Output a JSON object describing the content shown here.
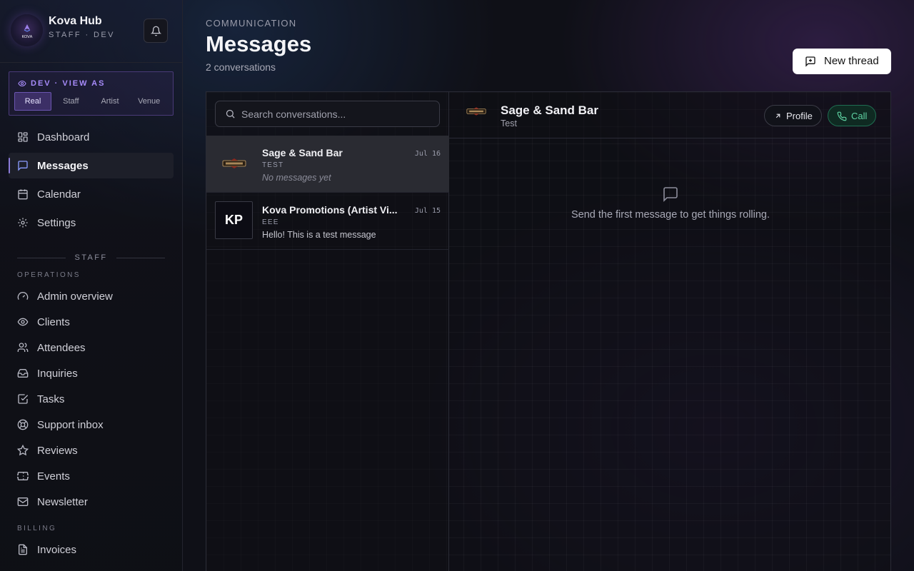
{
  "sidebar": {
    "app_title": "Kova Hub",
    "app_subtitle": "STAFF · DEV",
    "logo_text": "KOVA",
    "dev": {
      "label": "DEV · VIEW AS",
      "options": [
        "Real",
        "Staff",
        "Artist",
        "Venue"
      ],
      "selected": "Real"
    },
    "nav": [
      {
        "label": "Dashboard",
        "icon": "dashboard-icon"
      },
      {
        "label": "Messages",
        "icon": "message-icon",
        "active": true
      },
      {
        "label": "Calendar",
        "icon": "calendar-icon"
      },
      {
        "label": "Settings",
        "icon": "gear-icon"
      }
    ],
    "staff_section": "STAFF",
    "operations_group": "OPERATIONS",
    "operations": [
      {
        "label": "Admin overview",
        "icon": "gauge-icon"
      },
      {
        "label": "Clients",
        "icon": "eye-icon"
      },
      {
        "label": "Attendees",
        "icon": "users-icon"
      },
      {
        "label": "Inquiries",
        "icon": "inbox-icon"
      },
      {
        "label": "Tasks",
        "icon": "checkbox-icon"
      },
      {
        "label": "Support inbox",
        "icon": "lifebuoy-icon"
      },
      {
        "label": "Reviews",
        "icon": "star-icon"
      },
      {
        "label": "Events",
        "icon": "ticket-icon"
      },
      {
        "label": "Newsletter",
        "icon": "mail-icon"
      }
    ],
    "billing_group": "BILLING",
    "billing": [
      {
        "label": "Invoices",
        "icon": "document-icon"
      }
    ]
  },
  "header": {
    "eyebrow": "COMMUNICATION",
    "title": "Messages",
    "subtitle": "2 conversations",
    "new_thread_label": "New thread"
  },
  "search": {
    "placeholder": "Search conversations..."
  },
  "conversations": [
    {
      "name": "Sage & Sand Bar",
      "date": "Jul 16",
      "tag": "TEST",
      "preview": "No messages yet",
      "selected": true
    },
    {
      "name": "Kova Promotions (Artist Vi...",
      "date": "Jul 15",
      "tag": "EEE",
      "preview": "Hello! This is a test message",
      "avatar_text": "KP"
    }
  ],
  "chat": {
    "name": "Sage & Sand Bar",
    "subtitle": "Test",
    "profile_label": "Profile",
    "call_label": "Call",
    "empty_text": "Send the first message to get things rolling."
  },
  "colors": {
    "accent": "#8b7bd8",
    "dev_accent": "#a78bfa",
    "call_green": "#5fd3a3",
    "background": "#0f1017"
  }
}
